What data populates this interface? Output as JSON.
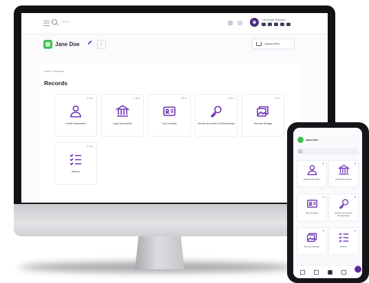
{
  "colors": {
    "accent": "#5a2b9c",
    "user_badge": "#3fbe52",
    "icon": "#6b2fb3",
    "monitor_bezel": "#121214",
    "screen_bg": "#fbfbfd"
  },
  "desktop": {
    "search_placeholder": "Search",
    "user_display_name": "Concierge Manager",
    "page_user": "Jane Doe",
    "upload_label": "Upload Files",
    "breadcrumb": "Home / Records",
    "section_title": "Records",
    "tiles": [
      {
        "label": "Health Information",
        "icon": "person-icon"
      },
      {
        "label": "Legal Documents",
        "icon": "bank-icon"
      },
      {
        "label": "Key Contacts",
        "icon": "contact-card-icon"
      },
      {
        "label": "Service Accounts & Memberships",
        "icon": "key-icon"
      },
      {
        "label": "Memory Storage",
        "icon": "photos-icon"
      },
      {
        "label": "Wishes",
        "icon": "checklist-icon"
      }
    ]
  },
  "phone": {
    "page_user": "Jane Doe",
    "search_placeholder": "Search",
    "tiles": [
      {
        "label": "Health Information",
        "icon": "person-icon"
      },
      {
        "label": "Legal Documents",
        "icon": "bank-icon"
      },
      {
        "label": "Key Contacts",
        "icon": "contact-card-icon"
      },
      {
        "label": "Service Accounts & Memberships",
        "icon": "key-icon"
      },
      {
        "label": "Memory Storage",
        "icon": "photos-icon"
      },
      {
        "label": "Wishes",
        "icon": "checklist-icon"
      }
    ]
  }
}
